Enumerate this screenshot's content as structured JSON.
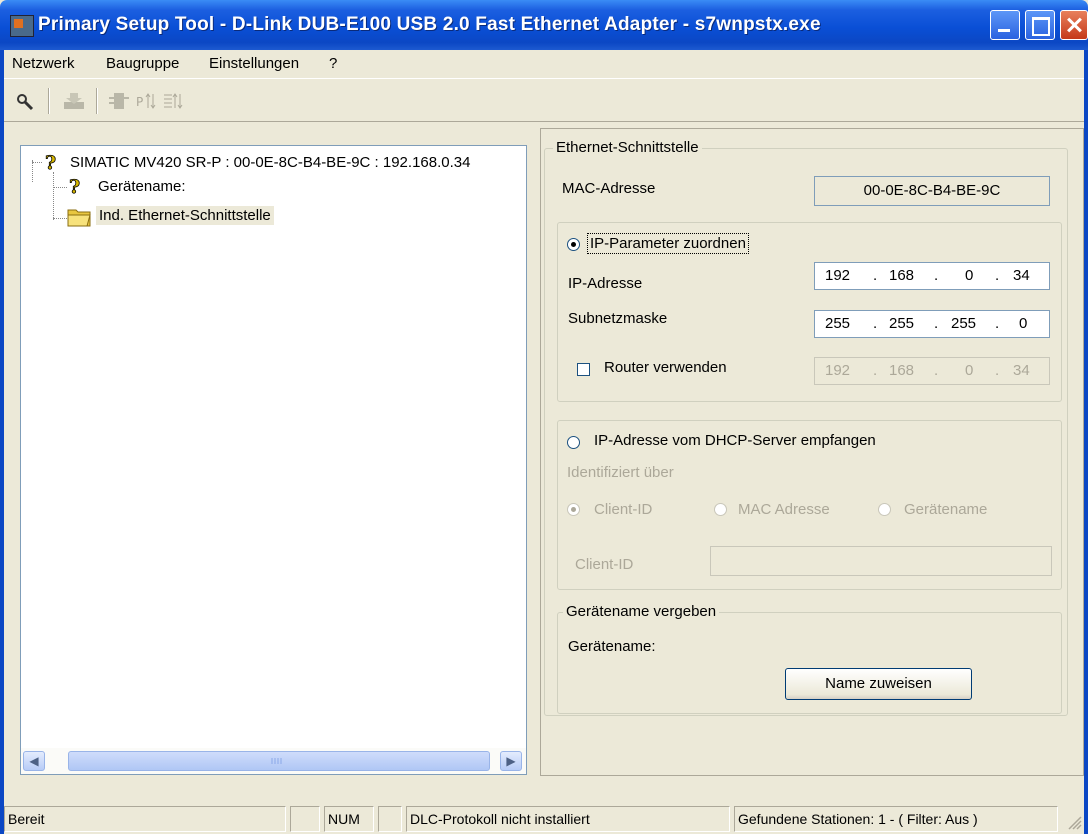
{
  "window": {
    "title": "Primary Setup Tool - D-Link DUB-E100 USB 2.0 Fast Ethernet Adapter - s7wnpstx.exe"
  },
  "menu": [
    "Netzwerk",
    "Baugruppe",
    "Einstellungen",
    "?"
  ],
  "toolbar": {
    "icons": [
      "browse-icon",
      "download-icon",
      "device-flash-icon",
      "address-icon",
      "list-address-icon"
    ]
  },
  "tree": {
    "root_label": "SIMATIC MV420 SR-P : 00-0E-8C-B4-BE-9C : 192.168.0.34",
    "child_device_name": "Gerätename:",
    "child_ethernet": "Ind. Ethernet-Schnittstelle"
  },
  "ethernet": {
    "group_title": "Ethernet-Schnittstelle",
    "mac_label": "MAC-Adresse",
    "mac_value": "00-0E-8C-B4-BE-9C",
    "ip_assign_label": "IP-Parameter zuordnen",
    "ip_label": "IP-Adresse",
    "ip": [
      "192",
      "168",
      "0",
      "34"
    ],
    "subnet_label": "Subnetzmaske",
    "subnet": [
      "255",
      "255",
      "255",
      "0"
    ],
    "router_label": "Router verwenden",
    "router": [
      "192",
      "168",
      "0",
      "34"
    ],
    "dhcp_label": "IP-Adresse vom DHCP-Server empfangen",
    "identified_by": "Identifiziert über",
    "opt_client_id": "Client-ID",
    "opt_mac": "MAC Adresse",
    "opt_devname": "Gerätename",
    "client_id_label": "Client-ID",
    "client_id_value": ""
  },
  "devname": {
    "group_title": "Gerätename vergeben",
    "label": "Gerätename:",
    "assign_button": "Name zuweisen"
  },
  "status": {
    "ready": "Bereit",
    "num": "NUM",
    "protocol": "DLC-Protokoll nicht installiert",
    "stations": "Gefundene Stationen: 1 - ( Filter: Aus )"
  }
}
